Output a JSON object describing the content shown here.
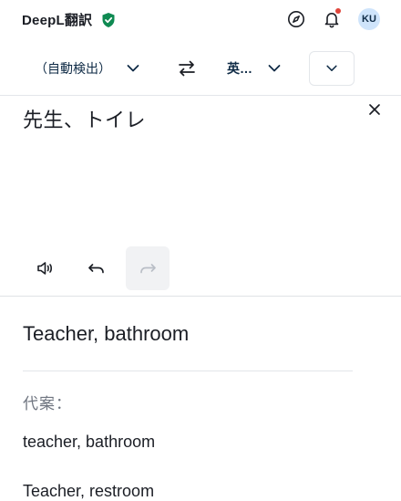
{
  "header": {
    "brand": "DeepL翻訳",
    "avatar": "KU",
    "icons": [
      "compass-icon",
      "bell-icon"
    ]
  },
  "languages": {
    "source": "（自動検出）",
    "target": "英…"
  },
  "source": {
    "text": "先生、トイレ"
  },
  "target": {
    "text": "Teacher, bathroom"
  },
  "alternatives": {
    "title": "代案：",
    "items": [
      "teacher, bathroom",
      "Teacher, restroom"
    ]
  },
  "colors": {
    "brand_text": "#1b1e25",
    "shield": "#0f8a52",
    "notif_dot": "#e0453b",
    "avatar_bg": "#cfe4fb",
    "lang_text": "#0f2b46"
  }
}
